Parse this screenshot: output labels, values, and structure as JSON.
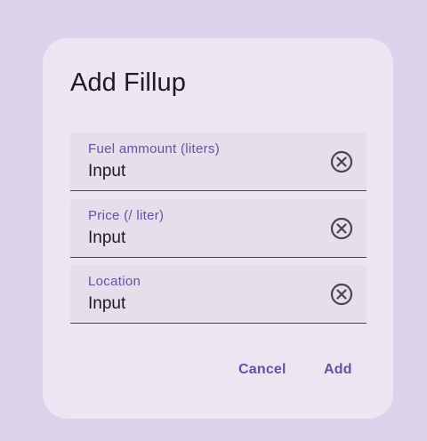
{
  "dialog": {
    "title": "Add Fillup",
    "fields": [
      {
        "label": "Fuel ammount (liters)",
        "value": "Input"
      },
      {
        "label": "Price (/ liter)",
        "value": "Input"
      },
      {
        "label": "Location",
        "value": "Input"
      }
    ],
    "cancel_label": "Cancel",
    "add_label": "Add"
  },
  "colors": {
    "primary": "#6750a4",
    "surface": "#ece6f3",
    "field_fill": "#e5dfec",
    "scrim": "#dcd2ea"
  }
}
